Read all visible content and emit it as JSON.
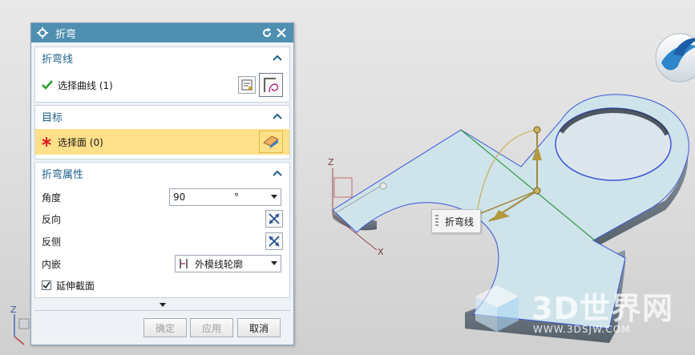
{
  "dialog": {
    "title": "折弯",
    "groups": {
      "bend_line": {
        "title": "折弯线",
        "select_curve_label": "选择曲线 (1)"
      },
      "target": {
        "title": "目标",
        "select_face_label": "选择面 (0)"
      },
      "bend_properties": {
        "title": "折弯属性",
        "angle_label": "角度",
        "angle_value": "90",
        "angle_unit": "°",
        "reverse_label": "反向",
        "reverse_side_label": "反侧",
        "inset_label": "内嵌",
        "inset_value": "外模线轮廓",
        "extend_section_label": "延伸截面",
        "extend_section_checked": true
      }
    },
    "buttons": {
      "ok": "确定",
      "apply": "应用",
      "cancel": "取消"
    }
  },
  "viewport": {
    "bend_line_tag": "折弯线",
    "axis_labels": {
      "z": "Z",
      "x": "X",
      "corner_z": "Z"
    },
    "watermark": {
      "text": "3D世界网",
      "url": "WWW.3DSJW.COM"
    }
  },
  "colors": {
    "titlebar": "#4f8fb0",
    "group_title": "#1c5f86",
    "selected_row": "#ffe08a",
    "part_face": "#cfe3ea",
    "part_side": "#7f8c96",
    "check": "#2aa02a",
    "required_star": "#e02020"
  }
}
